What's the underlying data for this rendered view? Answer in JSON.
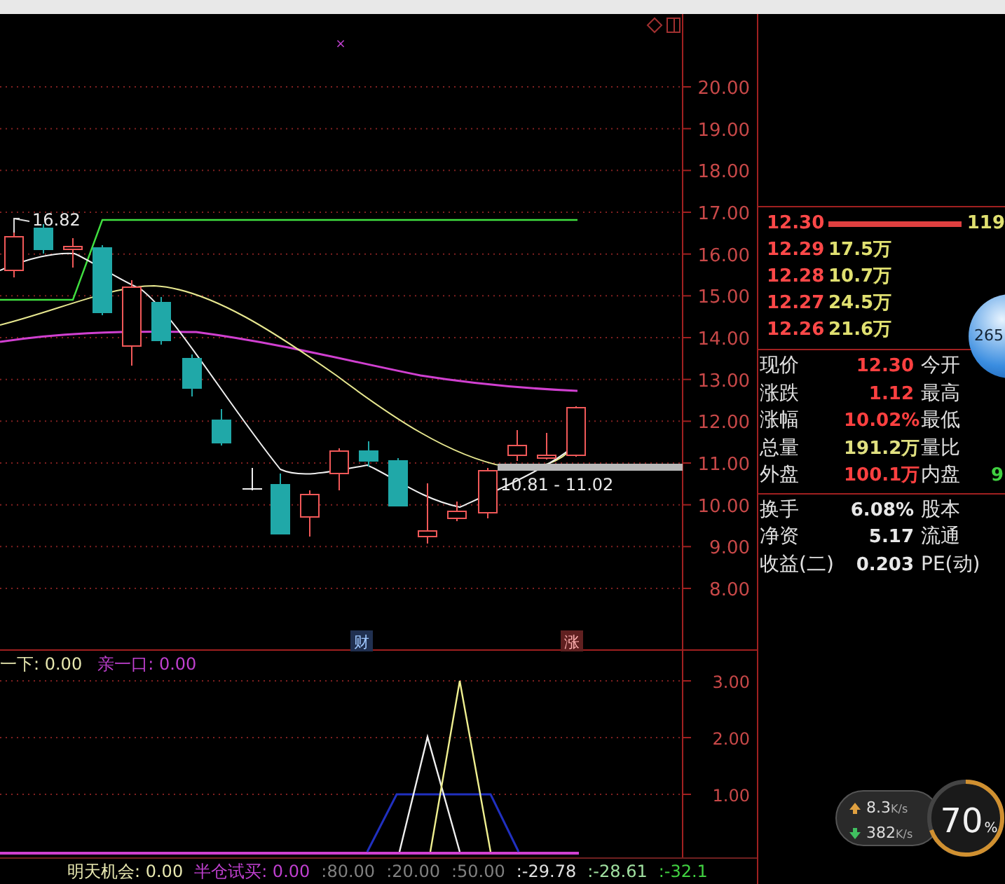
{
  "chart_toolbar": {
    "mark": "×"
  },
  "main_chart": {
    "price_axis": [
      "20.00",
      "19.00",
      "18.00",
      "17.00",
      "16.00",
      "15.00",
      "14.00",
      "13.00",
      "12.00",
      "11.00",
      "10.00",
      "9.00",
      "8.00"
    ],
    "high_label": "16.82",
    "range_label": "10.81 - 11.02",
    "event_markers": [
      {
        "label": "财",
        "kind": "finance"
      },
      {
        "label": "涨",
        "kind": "limit_up"
      }
    ]
  },
  "indicator": {
    "legend": [
      {
        "label": "一下: 0.00",
        "color": "#e8e8b0"
      },
      {
        "label": "亲一口: 0.00",
        "color": "#c040d0"
      }
    ],
    "axis": [
      "3.00",
      "2.00",
      "1.00"
    ]
  },
  "bottom_bar": [
    {
      "text": "明天机会: 0.00",
      "color": "#e8e8b0"
    },
    {
      "text": "半仓试买: 0.00",
      "color": "#c040d0"
    },
    {
      "text": ":80.00",
      "color": "#808080"
    },
    {
      "text": ":20.00",
      "color": "#808080"
    },
    {
      "text": ":50.00",
      "color": "#808080"
    },
    {
      "text": ":-29.78",
      "color": "#e0e0e0"
    },
    {
      "text": ":-28.61",
      "color": "#a0e0a0"
    },
    {
      "text": ":-32.1",
      "color": "#40d040"
    }
  ],
  "order_book": [
    {
      "price": "12.30",
      "kind": "bar",
      "volume": "119"
    },
    {
      "price": "12.29",
      "kind": "level",
      "volume": "17.5万"
    },
    {
      "price": "12.28",
      "kind": "level",
      "volume": "10.7万"
    },
    {
      "price": "12.27",
      "kind": "level",
      "volume": "24.5万"
    },
    {
      "price": "12.26",
      "kind": "level",
      "volume": "21.6万"
    }
  ],
  "quote": [
    {
      "label": "现价",
      "value": "12.30",
      "color": "#ff4040",
      "label2": "今开"
    },
    {
      "label": "涨跌",
      "value": "1.12",
      "color": "#ff4040",
      "label2": "最高"
    },
    {
      "label": "涨幅",
      "value": "10.02%",
      "color": "#ff4040",
      "label2": "最低"
    },
    {
      "label": "总量",
      "value": "191.2万",
      "color": "#e0e080",
      "label2": "量比"
    },
    {
      "label": "外盘",
      "value": "100.1万",
      "color": "#ff4040",
      "label2": "内盘",
      "extra": "9"
    }
  ],
  "fundamentals": [
    {
      "label": "换手",
      "value": "6.08%",
      "label2": "股本"
    },
    {
      "label": "净资",
      "value": "5.17",
      "label2": "流通"
    },
    {
      "label": "收益(二)",
      "value": "0.203",
      "label2": "PE(动)"
    }
  ],
  "floating_ball": {
    "text": "265"
  },
  "network_widget": {
    "upload": "8.3",
    "upload_unit": "K/s",
    "download": "382",
    "download_unit": "K/s",
    "percent": "70",
    "percent_sign": "%",
    "level": 0.7
  }
}
